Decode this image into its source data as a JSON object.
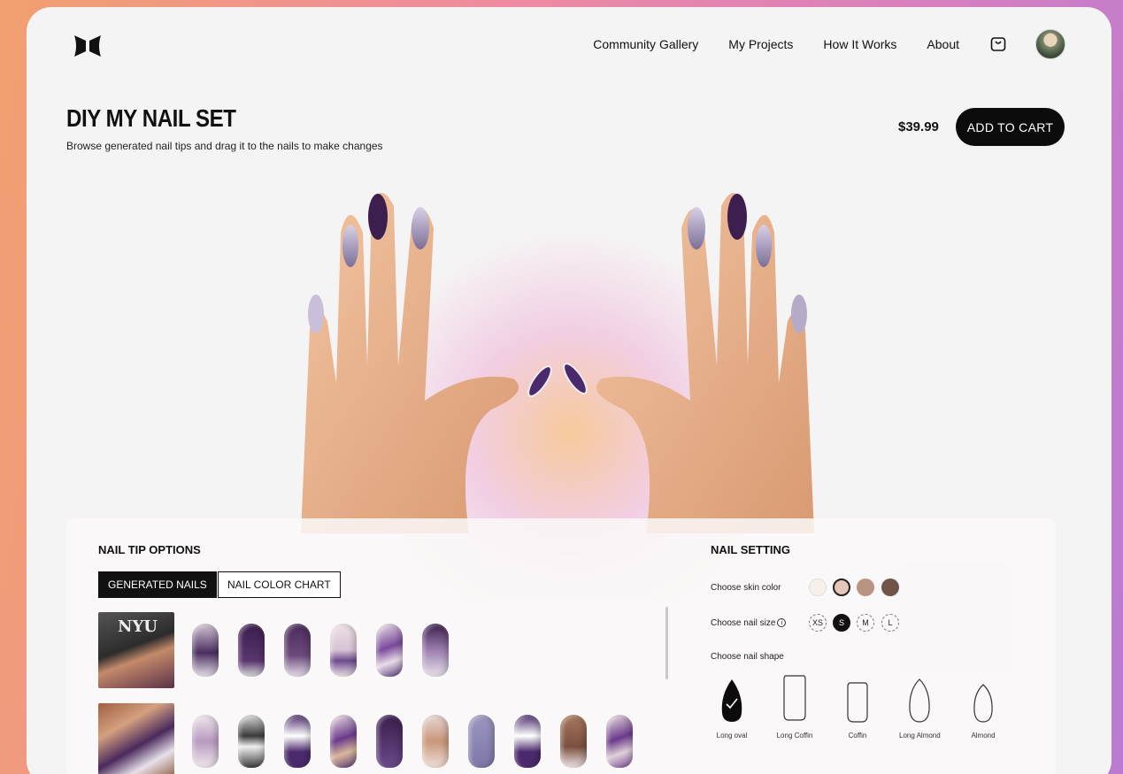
{
  "nav": {
    "links": [
      "Community Gallery",
      "My Projects",
      "How It Works",
      "About"
    ]
  },
  "header": {
    "title": "DIY MY NAIL SET",
    "subtitle": "Browse generated nail tips and drag it to the nails to make changes",
    "price": "$39.99",
    "add_to_cart": "ADD TO CART"
  },
  "tips_panel": {
    "title": "NAIL TIP OPTIONS",
    "tabs": [
      "GENERATED NAILS",
      "NAIL COLOR CHART"
    ],
    "active_tab": "GENERATED NAILS",
    "thumb1_text": "NYU"
  },
  "settings": {
    "title": "NAIL SETTING",
    "skin_label": "Choose skin color",
    "skin_colors": [
      "#f7efea",
      "#e6c6b7",
      "#b99482",
      "#705548"
    ],
    "selected_skin": 1,
    "size_label": "Choose nail size",
    "sizes": [
      "XS",
      "S",
      "M",
      "L"
    ],
    "selected_size": "S",
    "shape_label": "Choose nail shape",
    "shapes": [
      "Long oval",
      "Long Coffin",
      "Coffin",
      "Long Almond",
      "Almond"
    ],
    "selected_shape": "Long oval"
  },
  "colors": {
    "accent": "#0c0c0c",
    "purple": "#4a2a5c",
    "lilac": "#8c84b0"
  }
}
